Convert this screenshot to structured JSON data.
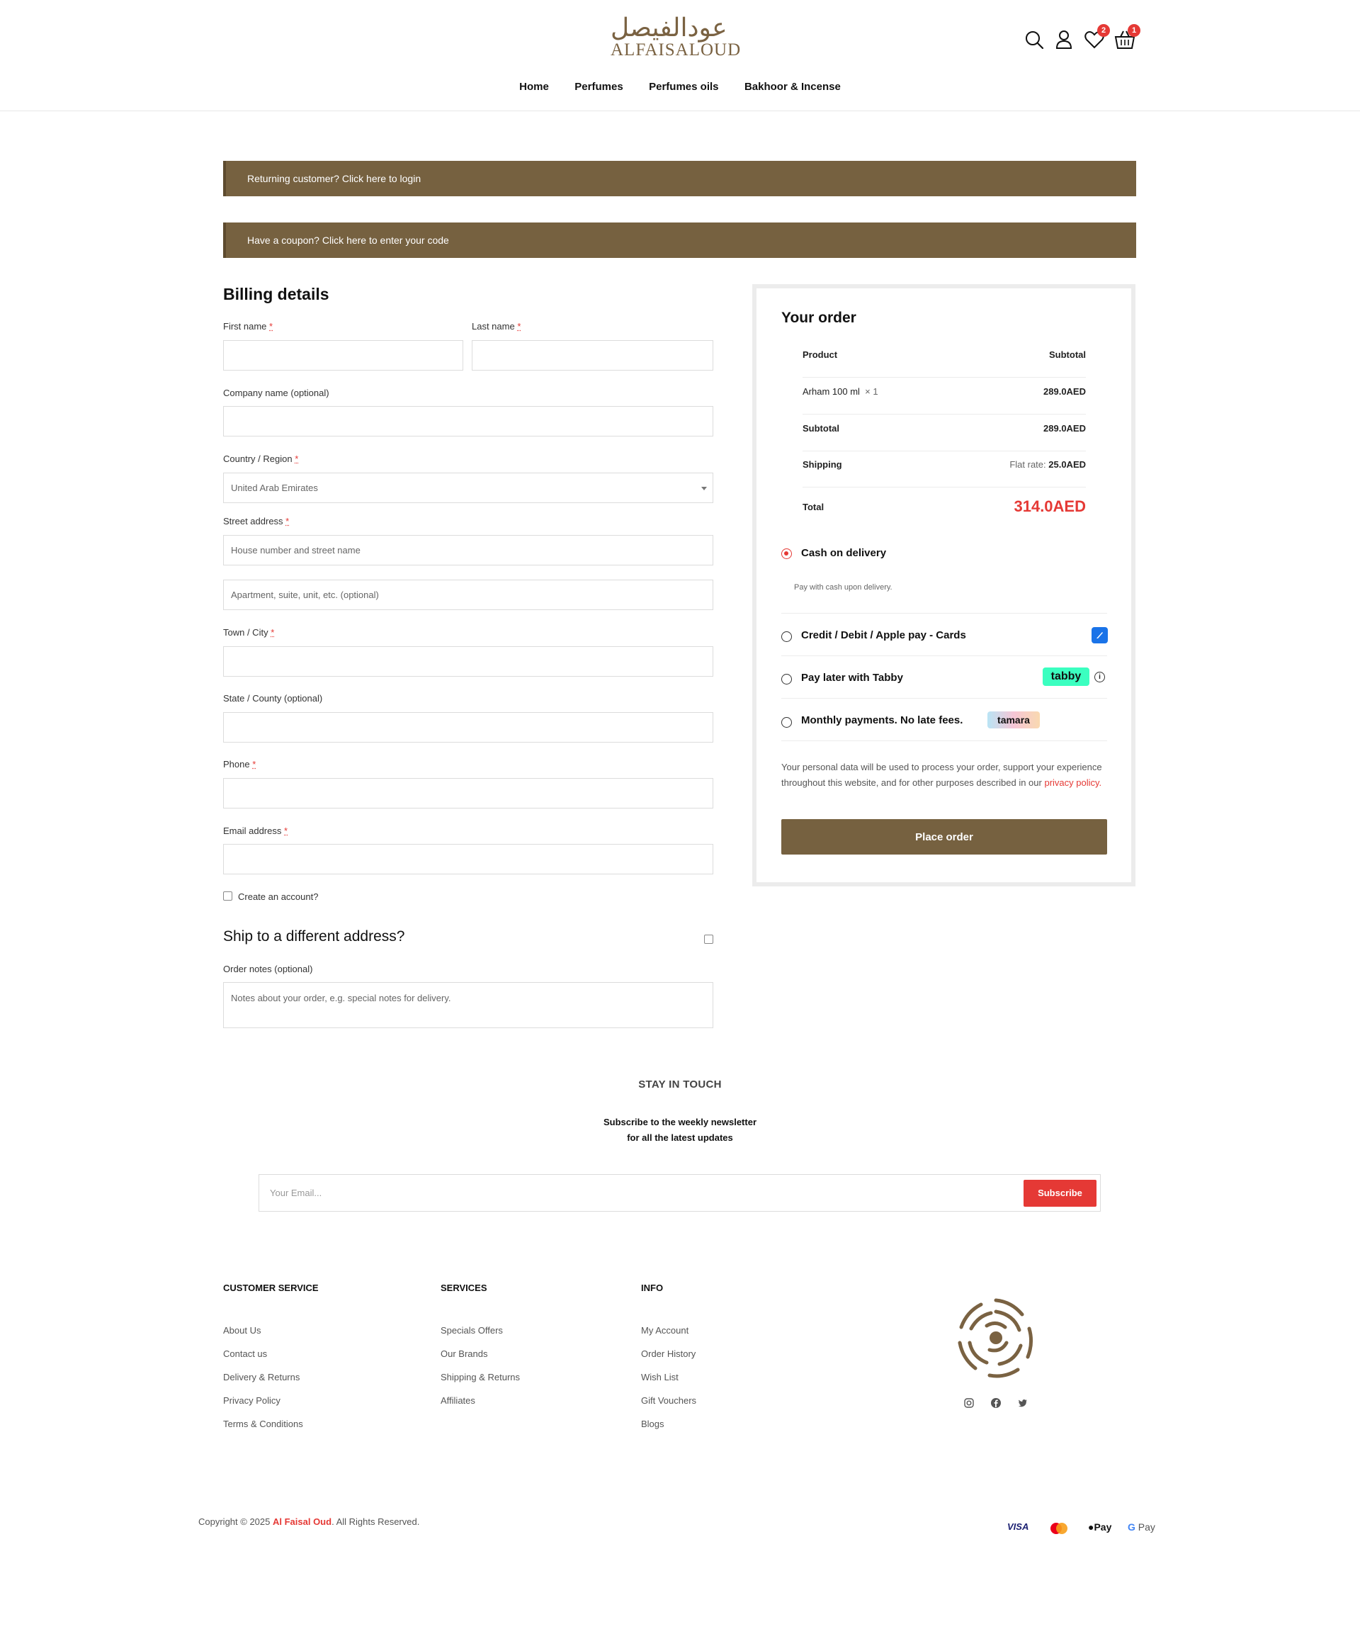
{
  "brand": {
    "logo_arabic": "عودالفيصل",
    "logo_latin": "ALFAISALOUD",
    "wishlist_count": "2",
    "cart_count": "1",
    "accent_color": "#766140",
    "highlight_color": "#e53935"
  },
  "nav": {
    "items": [
      "Home",
      "Perfumes",
      "Perfumes oils",
      "Bakhoor & Incense"
    ]
  },
  "notices": {
    "login": "Returning customer? Click here to login",
    "coupon": "Have a coupon? Click here to enter your code"
  },
  "billing": {
    "title": "Billing details",
    "first_name_label": "First name",
    "last_name_label": "Last name",
    "company_label": "Company name (optional)",
    "country_label": "Country / Region",
    "country_value": "United Arab Emirates",
    "street_label": "Street address",
    "street_placeholder_1": "House number and street name",
    "street_placeholder_2": "Apartment, suite, unit, etc. (optional)",
    "city_label": "Town / City",
    "state_label": "State / County (optional)",
    "phone_label": "Phone",
    "email_label": "Email address",
    "required_mark": "*",
    "create_account_label": "Create an account?",
    "ship_different_label": "Ship to a different address?",
    "order_notes_label": "Order notes (optional)",
    "order_notes_placeholder": "Notes about your order, e.g. special notes for delivery."
  },
  "order": {
    "title": "Your order",
    "col_product": "Product",
    "col_subtotal": "Subtotal",
    "item_name": "Arham 100 ml",
    "item_qty": "× 1",
    "item_price": "289.0AED",
    "subtotal_label": "Subtotal",
    "subtotal_value": "289.0AED",
    "shipping_label": "Shipping",
    "shipping_prefix": "Flat rate:",
    "shipping_value": "25.0AED",
    "total_label": "Total",
    "total_value": "314.0AED",
    "payment_methods": [
      {
        "label": "Cash on delivery",
        "selected": true,
        "description": "Pay with cash upon delivery."
      },
      {
        "label": "Credit / Debit / Apple pay - Cards",
        "selected": false
      },
      {
        "label": "Pay later with Tabby",
        "selected": false,
        "badge": "tabby"
      },
      {
        "label": "Monthly payments. No late fees.",
        "selected": false,
        "badge": "tamara"
      }
    ],
    "privacy_text": "Your personal data will be used to process your order, support your experience throughout this website, and for other purposes described in our",
    "privacy_link": "privacy policy.",
    "place_order": "Place order"
  },
  "newsletter": {
    "heading": "STAY IN TOUCH",
    "line1": "Subscribe to the weekly newsletter",
    "line2": "for all the latest updates",
    "placeholder": "Your Email...",
    "button": "Subscribe"
  },
  "footer": {
    "columns": [
      {
        "title": "CUSTOMER SERVICE",
        "links": [
          "About Us",
          "Contact us",
          "Delivery & Returns",
          "Privacy Policy",
          "Terms & Conditions"
        ]
      },
      {
        "title": "SERVICES",
        "links": [
          "Specials Offers",
          "Our Brands",
          "Shipping & Returns",
          "Affiliates"
        ]
      },
      {
        "title": "INFO",
        "links": [
          "My Account",
          "Order History",
          "Wish List",
          "Gift Vouchers",
          "Blogs"
        ]
      }
    ],
    "social": [
      "instagram-icon",
      "facebook-icon",
      "twitter-icon"
    ],
    "copyright_prefix": "Copyright © 2025",
    "copyright_brand": "Al Faisal Oud",
    "copyright_suffix": ". All Rights Reserved.",
    "payments": [
      "VISA",
      "Pay",
      "Pay"
    ]
  }
}
